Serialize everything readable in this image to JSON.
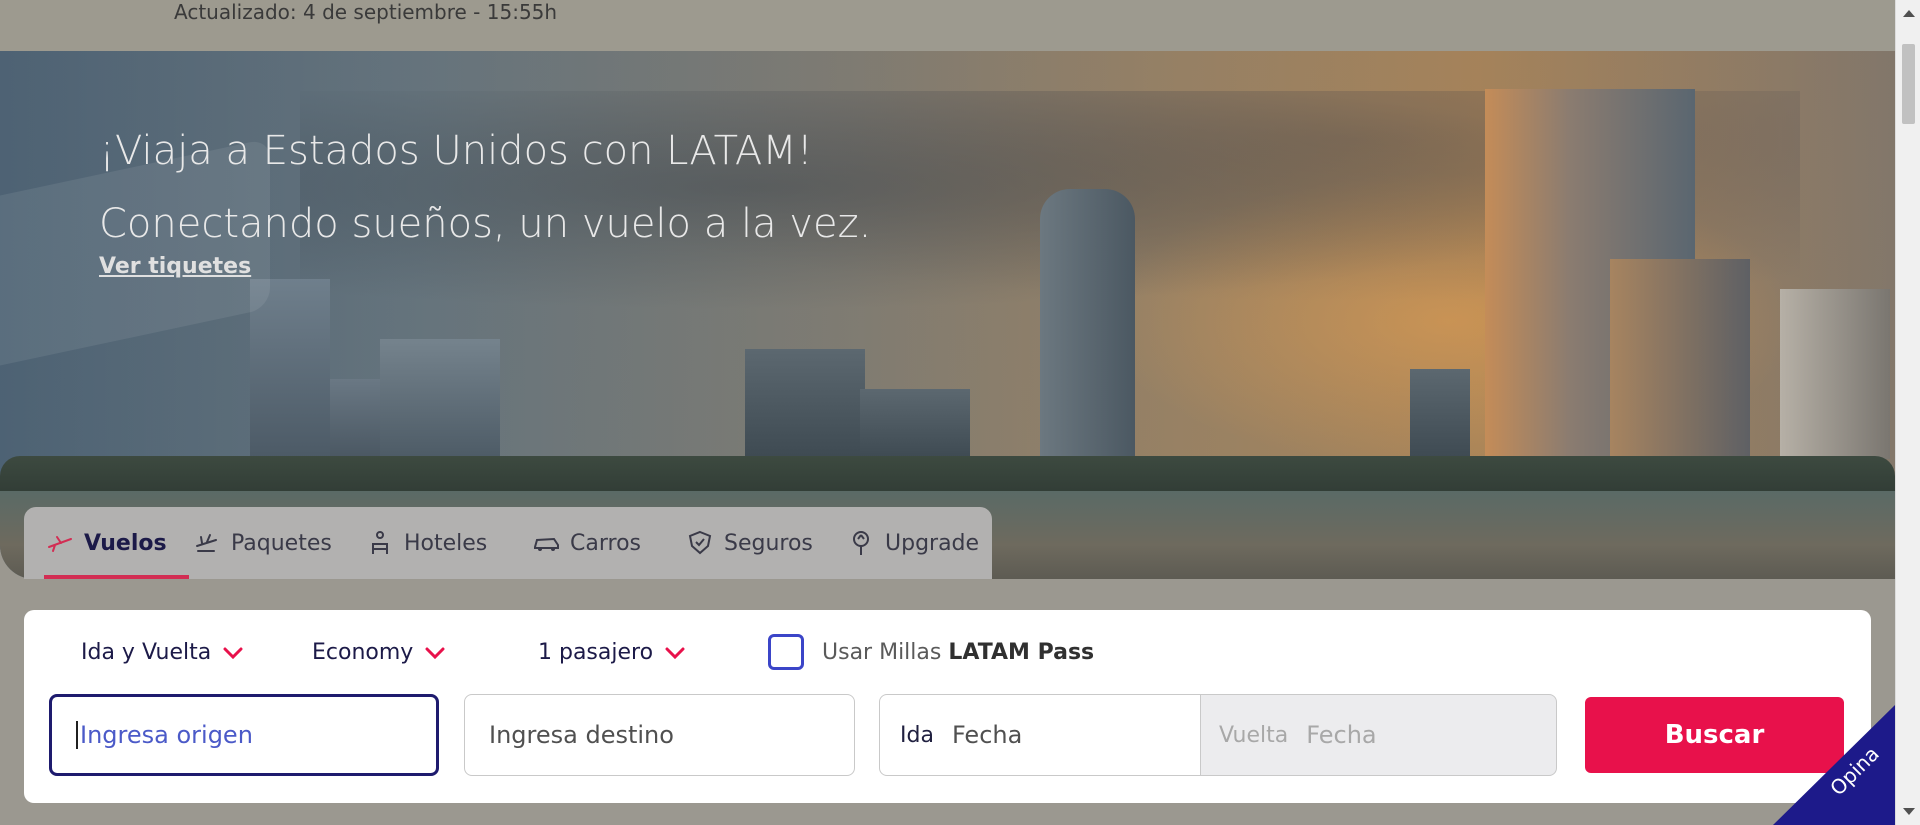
{
  "status": {
    "updated": "Actualizado: 4 de septiembre - 15:55h"
  },
  "hero": {
    "headline": "¡Viaja a Estados Unidos con LATAM! Conectando sueños, un vuelo a la vez.",
    "link_label": "Ver tiquetes"
  },
  "tabs": [
    {
      "label": "Vuelos",
      "icon": "plane-icon",
      "active": true
    },
    {
      "label": "Paquetes",
      "icon": "package-icon",
      "active": false
    },
    {
      "label": "Hoteles",
      "icon": "hotel-icon",
      "active": false
    },
    {
      "label": "Carros",
      "icon": "car-icon",
      "active": false
    },
    {
      "label": "Seguros",
      "icon": "shield-icon",
      "active": false
    },
    {
      "label": "Upgrade",
      "icon": "upgrade-icon",
      "active": false
    }
  ],
  "search": {
    "trip_type": "Ida y Vuelta",
    "cabin": "Economy",
    "passengers": "1 pasajero",
    "miles_label": "Usar Millas",
    "miles_brand": "LATAM Pass",
    "origin_placeholder": "Ingresa origen",
    "destination_placeholder": "Ingresa destino",
    "ida_label": "Ida",
    "ida_placeholder": "Fecha",
    "vuelta_label": "Vuelta",
    "vuelta_placeholder": "Fecha",
    "search_button": "Buscar"
  },
  "feedback": {
    "label": "Opina"
  },
  "colors": {
    "accent": "#e8114b",
    "brand_navy": "#1c1a48",
    "tab_underline": "#d22d53",
    "checkbox": "#3b45c8",
    "opina": "#1d1a8a"
  }
}
